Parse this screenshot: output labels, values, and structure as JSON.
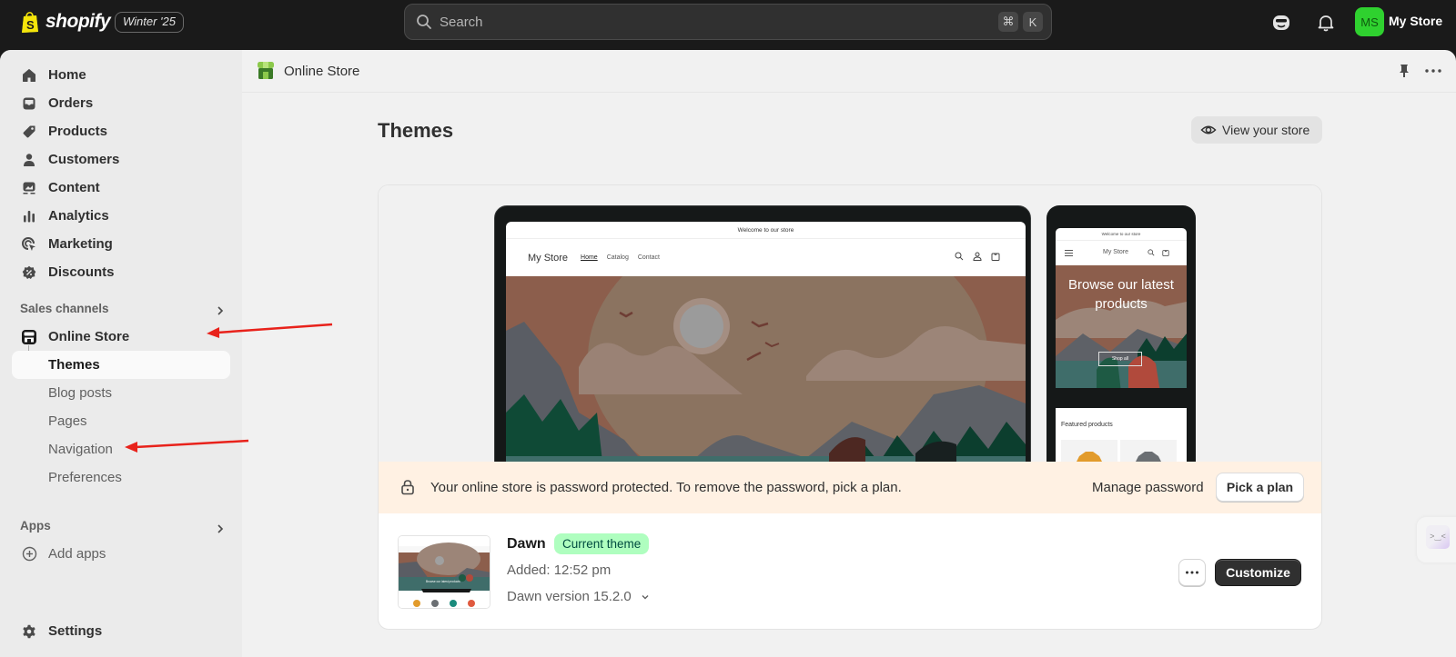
{
  "topbar": {
    "brand": "shopify",
    "edition_badge": "Winter '25",
    "search_placeholder": "Search",
    "shortcut_keys": [
      "⌘",
      "K"
    ],
    "avatar_initials": "MS",
    "store_name": "My Store",
    "avatar_color": "#2fd12f"
  },
  "sidebar": {
    "main_items": [
      {
        "label": "Home",
        "icon": "home-icon"
      },
      {
        "label": "Orders",
        "icon": "inbox-icon"
      },
      {
        "label": "Products",
        "icon": "tag-icon"
      },
      {
        "label": "Customers",
        "icon": "person-icon"
      },
      {
        "label": "Content",
        "icon": "image-icon"
      },
      {
        "label": "Analytics",
        "icon": "bar-chart-icon"
      },
      {
        "label": "Marketing",
        "icon": "target-icon"
      },
      {
        "label": "Discounts",
        "icon": "discount-icon"
      }
    ],
    "sales_channels_heading": "Sales channels",
    "online_store_label": "Online Store",
    "online_store_sub": [
      {
        "label": "Themes",
        "active": true
      },
      {
        "label": "Blog posts",
        "active": false
      },
      {
        "label": "Pages",
        "active": false
      },
      {
        "label": "Navigation",
        "active": false
      },
      {
        "label": "Preferences",
        "active": false
      }
    ],
    "apps_heading": "Apps",
    "add_apps_label": "Add apps",
    "settings_label": "Settings"
  },
  "header": {
    "section_title": "Online Store"
  },
  "page": {
    "title": "Themes",
    "view_store_label": "View your store"
  },
  "preview": {
    "announcement": "Welcome to our store",
    "store_name": "My Store",
    "nav_links": [
      "Home",
      "Catalog",
      "Contact"
    ],
    "mobile_hero_text": "Browse our latest products",
    "mobile_hero_button": "Shop all",
    "featured_heading": "Featured products"
  },
  "banner": {
    "message": "Your online store is password protected. To remove the password, pick a plan.",
    "manage_password_label": "Manage password",
    "pick_plan_label": "Pick a plan",
    "background": "#fff1e3"
  },
  "theme": {
    "name": "Dawn",
    "badge": "Current theme",
    "badge_color": "#affebf",
    "added": "Added: 12:52 pm",
    "version": "Dawn version 15.2.0",
    "customize_label": "Customize"
  },
  "annotations": {
    "arrow_color": "#e8221b",
    "targets": [
      "Online Store",
      "Navigation"
    ]
  }
}
